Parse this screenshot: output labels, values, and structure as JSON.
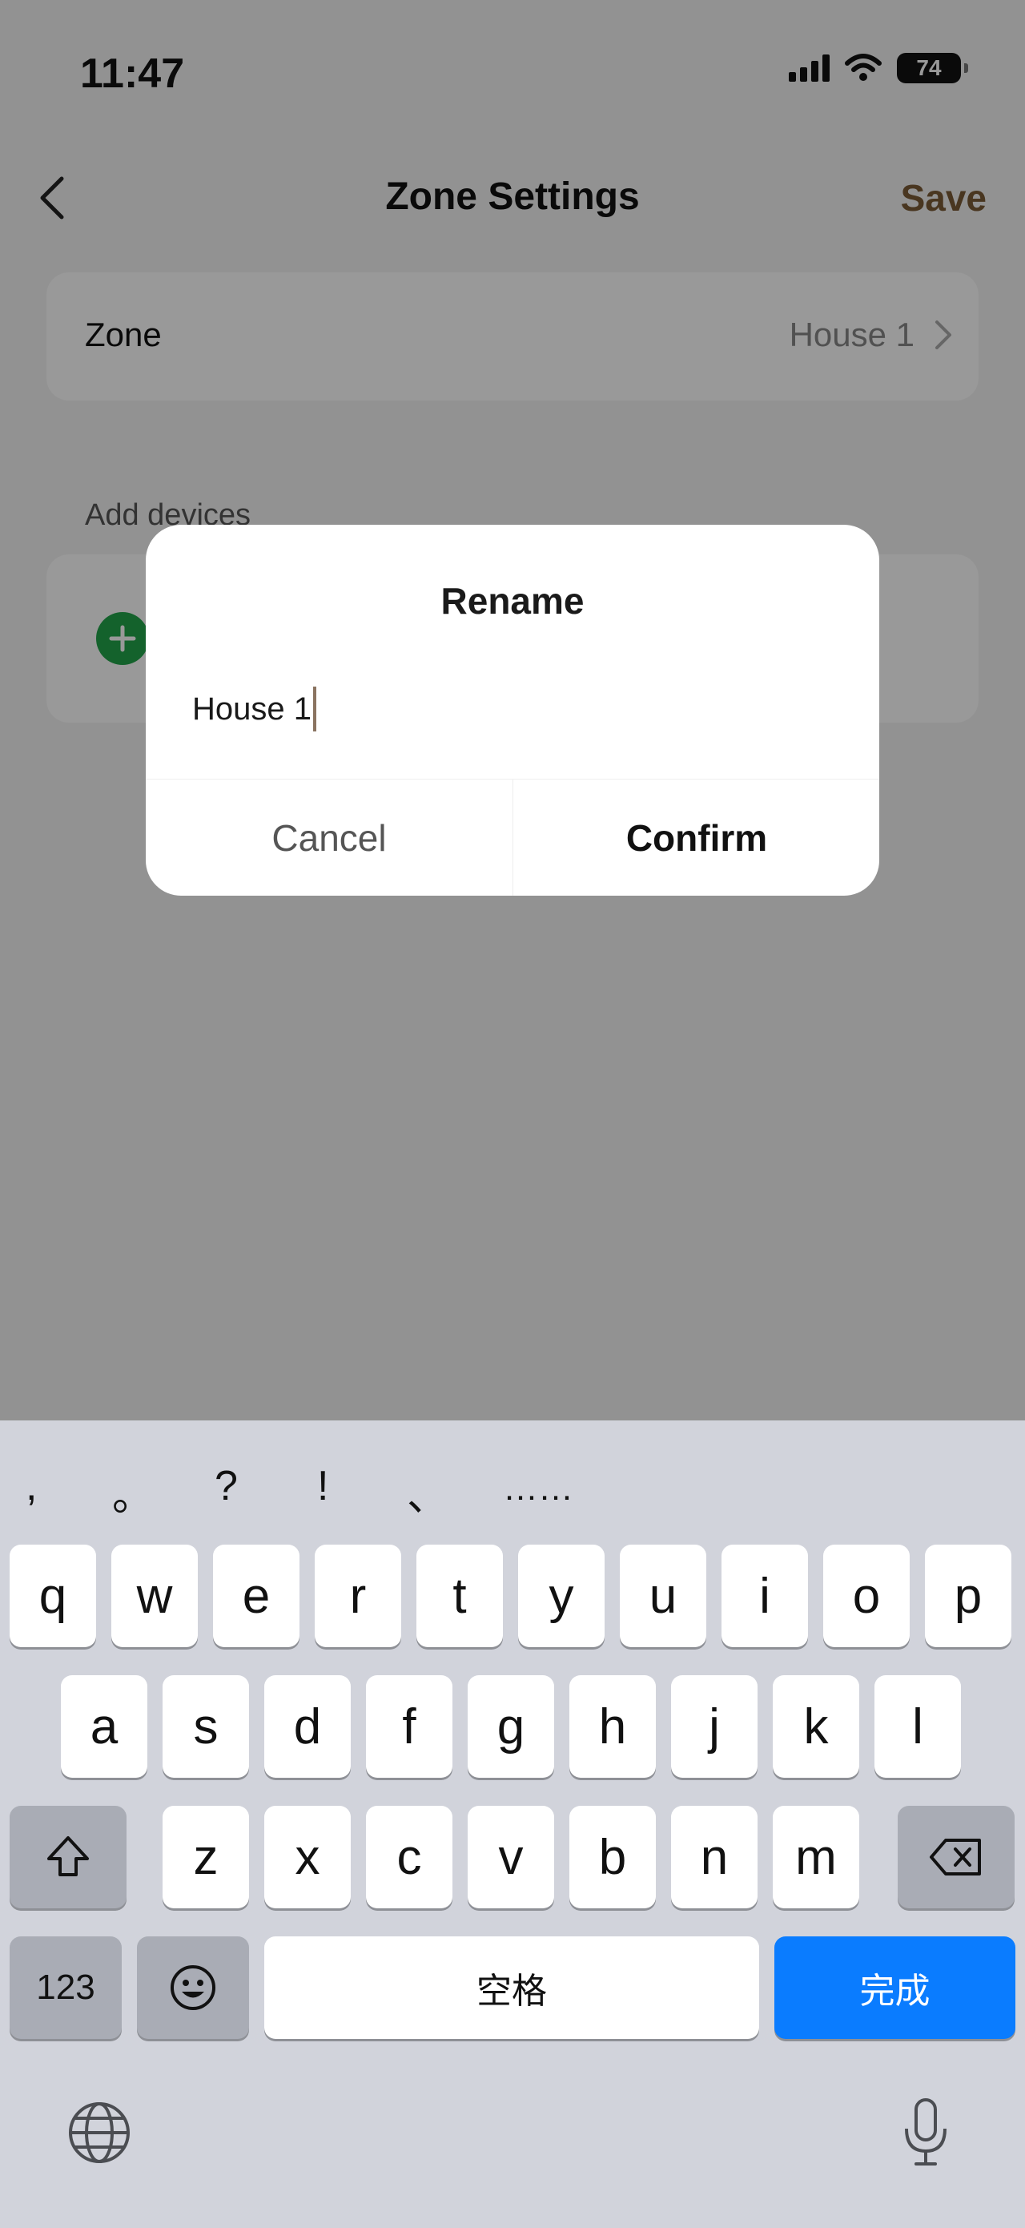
{
  "status_bar": {
    "time": "11:47",
    "battery": "74"
  },
  "nav": {
    "title": "Zone Settings",
    "save_label": "Save"
  },
  "zone_row": {
    "label": "Zone",
    "value": "House 1"
  },
  "devices": {
    "section_label": "Add devices"
  },
  "dialog": {
    "title": "Rename",
    "input_value": "House 1",
    "cancel_label": "Cancel",
    "confirm_label": "Confirm"
  },
  "keyboard": {
    "punctuation": [
      ",",
      "。",
      "?",
      "!",
      "、",
      "……"
    ],
    "row1": [
      "q",
      "w",
      "e",
      "r",
      "t",
      "y",
      "u",
      "i",
      "o",
      "p"
    ],
    "row2": [
      "a",
      "s",
      "d",
      "f",
      "g",
      "h",
      "j",
      "k",
      "l"
    ],
    "row3": [
      "z",
      "x",
      "c",
      "v",
      "b",
      "n",
      "m"
    ],
    "numbers_label": "123",
    "space_label": "空格",
    "done_label": "完成",
    "icons": {
      "shift": "shift-icon",
      "delete": "delete-icon",
      "emoji": "emoji-icon",
      "globe": "globe-icon",
      "mic": "microphone-icon"
    }
  },
  "colors": {
    "save": "#7a5a36",
    "add_button": "#22a34a",
    "done_key": "#0a7cff",
    "keyboard_bg": "#d1d3db"
  }
}
